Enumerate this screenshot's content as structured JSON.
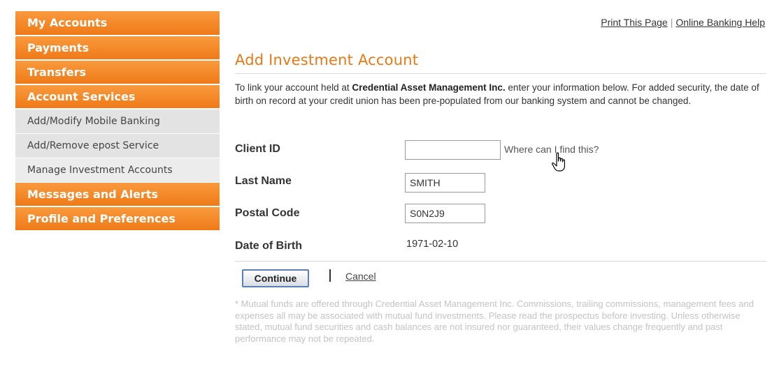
{
  "sidebar": {
    "items": [
      {
        "label": "My Accounts",
        "type": "main"
      },
      {
        "label": "Payments",
        "type": "main"
      },
      {
        "label": "Transfers",
        "type": "main"
      },
      {
        "label": "Account Services",
        "type": "main"
      },
      {
        "label": "Add/Modify Mobile Banking",
        "type": "sub"
      },
      {
        "label": "Add/Remove epost Service",
        "type": "sub"
      },
      {
        "label": "Manage Investment Accounts",
        "type": "sub",
        "active": true
      },
      {
        "label": "Messages and Alerts",
        "type": "main"
      },
      {
        "label": "Profile and Preferences",
        "type": "main"
      }
    ]
  },
  "top_links": {
    "print": "Print This Page",
    "separator": "|",
    "help": "Online Banking Help"
  },
  "main": {
    "title": "Add Investment Account",
    "intro_pre": "To link your account held at ",
    "intro_company": "Credential Asset Management Inc.",
    "intro_post": " enter your information below. For added security, the date of birth on record at your credit union has been pre-populated from our banking system and cannot be changed.",
    "form": {
      "client_id_label": "Client ID",
      "client_id_value": "",
      "client_id_help": "Where can I find this?",
      "last_name_label": "Last Name",
      "last_name_value": "SMITH",
      "postal_code_label": "Postal Code",
      "postal_code_value": "S0N2J9",
      "dob_label": "Date of Birth",
      "dob_value": "1971-02-10"
    },
    "actions": {
      "continue_label": "Continue",
      "separator": "|",
      "cancel_label": "Cancel"
    },
    "disclaimer": "* Mutual funds are offered through Credential Asset Management Inc. Commissions, trailing commissions, management fees and expenses all may be associated with mutual fund investments. Please read the prospectus before investing. Unless otherwise stated, mutual fund securities and cash balances are not insured nor guaranteed, their values change frequently and past performance may not be repeated."
  },
  "colors": {
    "accent": "#ef7a17",
    "title": "#e97816",
    "button_border": "#5b7fb8"
  },
  "icons": {
    "cursor": "hand-pointer-icon"
  }
}
